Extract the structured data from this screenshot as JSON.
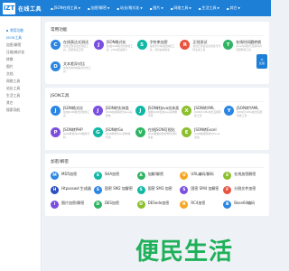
{
  "header": {
    "logo_mark": "iZT",
    "logo_text": "在线工具",
    "nav": [
      {
        "label": "JSON在线工具",
        "has_caret": true,
        "icon": "braces-icon"
      },
      {
        "label": "加密/解密",
        "has_caret": true,
        "icon": "lock-icon"
      },
      {
        "label": "站长/格式化",
        "has_caret": true,
        "icon": "code-icon"
      },
      {
        "label": "图片",
        "has_caret": true,
        "icon": "image-icon"
      },
      {
        "label": "网络工具",
        "has_caret": true,
        "icon": "network-icon"
      },
      {
        "label": "生活工具",
        "has_caret": true,
        "icon": "life-icon"
      },
      {
        "label": "其它",
        "has_caret": true,
        "icon": "more-icon"
      }
    ]
  },
  "sidebar": {
    "items": [
      {
        "label": "常用功能",
        "state": "head"
      },
      {
        "label": "JSON工具",
        "state": "active"
      },
      {
        "label": "加密/解密",
        "state": "normal"
      },
      {
        "label": "压缩/格式化",
        "state": "normal"
      },
      {
        "label": "转换",
        "state": "normal"
      },
      {
        "label": "图片",
        "state": "normal"
      },
      {
        "label": "文档",
        "state": "normal"
      },
      {
        "label": "网络工具",
        "state": "normal"
      },
      {
        "label": "站长工具",
        "state": "normal"
      },
      {
        "label": "生活工具",
        "state": "normal"
      },
      {
        "label": "其它",
        "state": "normal"
      },
      {
        "label": "搜索导航",
        "state": "normal"
      }
    ]
  },
  "sections": [
    {
      "title": "常用功能",
      "cards": [
        {
          "title": "在线表达式测试",
          "desc": "在线正则表达式测试工具，匹配验证正则",
          "icon_letter": "C",
          "color": "c-blue"
        },
        {
          "title": "JSON格式化",
          "desc": "在线JSON格式化校验工具，JSON压缩转义",
          "icon_letter": "J",
          "color": "c-purple"
        },
        {
          "title": "字符串加密",
          "desc": "在线字符串加密解密工具，支持多种算法",
          "icon_letter": "S",
          "color": "c-teal"
        },
        {
          "title": "正则测试",
          "desc": "在线正则表达式测试与代码生成工具",
          "icon_letter": "R",
          "color": "c-red"
        },
        {
          "title": "在线时间戳转换",
          "desc": "Unix时间戳与日期时间互相转换工具",
          "icon_letter": "T",
          "color": "c-green"
        },
        {
          "title": "文本差异对比",
          "desc": "在线文本内容差异比较工具",
          "icon_letter": "D",
          "color": "c-blue"
        }
      ]
    },
    {
      "title": "JSON工具",
      "cards": [
        {
          "title": "JSON格式化",
          "desc": "在线JSON格式化校验工具",
          "icon_letter": "J",
          "color": "c-blue"
        },
        {
          "title": "JSON转实体类",
          "desc": "JSON在线转换为Java实体类",
          "icon_letter": "J",
          "color": "c-purple"
        },
        {
          "title": "JSON转Java实体类",
          "desc": "根据JSON生成Java实体类代码",
          "icon_letter": "J",
          "color": "c-teal"
        },
        {
          "title": "JSON转XML",
          "desc": "JSON与XML格式互相转换工具",
          "icon_letter": "X",
          "color": "c-olive"
        },
        {
          "title": "JSON转YAML",
          "desc": "JSON与YAML格式互相转换工具",
          "icon_letter": "Y",
          "color": "c-blue"
        },
        {
          "title": "JSON转PHP",
          "desc": "JSON转换为PHP数组代码",
          "icon_letter": "P",
          "color": "c-purple"
        },
        {
          "title": "JSON转Go",
          "desc": "JSON转换为Go结构体代码",
          "icon_letter": "G",
          "color": "c-teal"
        },
        {
          "title": "在线JSON可视化",
          "desc": "JSON数据树形结构可视化查看",
          "icon_letter": "V",
          "color": "c-green"
        },
        {
          "title": "JSON转Excel",
          "desc": "JSON数据转换为Excel表格",
          "icon_letter": "E",
          "color": "c-olive"
        }
      ]
    },
    {
      "title": "加密/解密",
      "cards": [
        {
          "title": "MD5加密",
          "desc": "",
          "icon_letter": "M",
          "color": "c-blue"
        },
        {
          "title": "SHA加密",
          "desc": "",
          "icon_letter": "S",
          "color": "c-teal"
        },
        {
          "title": "加解/解密",
          "desc": "",
          "icon_letter": "A",
          "color": "c-green"
        },
        {
          "title": "URL编码/解码",
          "desc": "",
          "icon_letter": "U",
          "color": "c-orange"
        },
        {
          "title": "在线加密解密",
          "desc": "",
          "icon_letter": "E",
          "color": "c-olive"
        },
        {
          "title": "Htpasswd 生成器",
          "desc": "",
          "icon_letter": "H",
          "color": "c-navy"
        },
        {
          "title": "国密 SM2 加解密",
          "desc": "",
          "icon_letter": "S",
          "color": "c-blue"
        },
        {
          "title": "国密 SM3 加密",
          "desc": "",
          "icon_letter": "S",
          "color": "c-teal"
        },
        {
          "title": "国密 SM4 加解密",
          "desc": "",
          "icon_letter": "S",
          "color": "c-purple"
        },
        {
          "title": "分割文件加密",
          "desc": "",
          "icon_letter": "F",
          "color": "c-red"
        },
        {
          "title": "图片加密/解密",
          "desc": "",
          "icon_letter": "I",
          "color": "c-purple"
        },
        {
          "title": "DES加密",
          "desc": "",
          "icon_letter": "D",
          "color": "c-green"
        },
        {
          "title": "DESede加密",
          "desc": "",
          "icon_letter": "D",
          "color": "c-olive"
        },
        {
          "title": "RC4加密",
          "desc": "",
          "icon_letter": "R",
          "color": "c-orange"
        },
        {
          "title": "Base64编码",
          "desc": "",
          "icon_letter": "B",
          "color": "c-blue"
        }
      ]
    }
  ],
  "float_button": {
    "label": "反馈"
  },
  "watermark": {
    "text": "便民生活"
  }
}
